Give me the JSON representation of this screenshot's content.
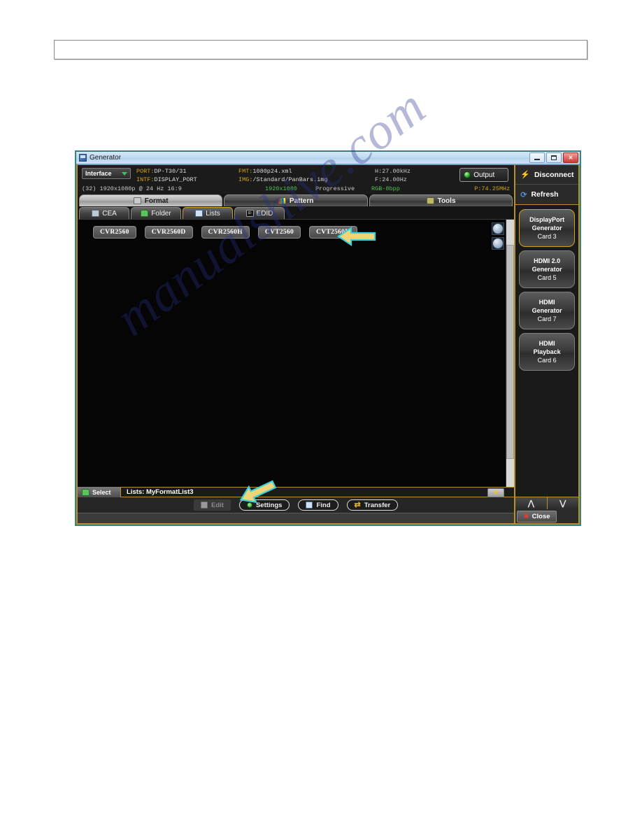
{
  "window": {
    "title": "Generator",
    "controls": {
      "minimize": "–",
      "maximize": "□",
      "close": "✕"
    }
  },
  "info": {
    "interface_label": "Interface",
    "port_key": "PORT:",
    "port_value": "DP-T30/31",
    "intf_key": "INTF:",
    "intf_value": "DISPLAY_PORT",
    "fmt_key": "FMT:",
    "fmt_value": "1080p24.xml",
    "img_key": "IMG:",
    "img_value": "/Standard/PanBars.img",
    "h_freq": "H:27.00kHz",
    "f_freq": "F:24.00Hz",
    "output_label": "Output",
    "format_desc": "(32) 1920x1080p @ 24 Hz 16:9",
    "resolution": "1920x1080",
    "scan": "Progressive",
    "color_depth": "RGB-8bpp",
    "pixel_clock": "P:74.25MHz"
  },
  "tabs_main": [
    {
      "label": "Format",
      "icon": "monitor-icon",
      "active": true
    },
    {
      "label": "Pattern",
      "icon": "pattern-icon",
      "active": false
    },
    {
      "label": "Tools",
      "icon": "tools-icon",
      "active": false
    }
  ],
  "tabs_sub": [
    {
      "label": "CEA",
      "icon": "cea-icon",
      "active": false
    },
    {
      "label": "Folder",
      "icon": "folder-icon",
      "active": false
    },
    {
      "label": "Lists",
      "icon": "lists-icon",
      "active": true
    },
    {
      "label": "EDID",
      "icon": "edid-icon",
      "active": false
    }
  ],
  "format_chips": [
    {
      "label": "CVR2560"
    },
    {
      "label": "CVR2560D"
    },
    {
      "label": "CVR2560H"
    },
    {
      "label": "CVT2560"
    },
    {
      "label": "CVT2560H"
    }
  ],
  "list_bar": {
    "select_label": "Select",
    "list_text": "Lists: MyFormatList3",
    "star_glyph": "★"
  },
  "actions": [
    {
      "label": "Edit",
      "icon": "edit-icon",
      "disabled": true
    },
    {
      "label": "Settings",
      "icon": "settings-icon",
      "disabled": false
    },
    {
      "label": "Find",
      "icon": "find-icon",
      "disabled": false
    },
    {
      "label": "Transfer",
      "icon": "transfer-icon",
      "disabled": false
    }
  ],
  "sidebar": {
    "disconnect_label": "Disconnect",
    "refresh_label": "Refresh",
    "cards": [
      {
        "line1": "DisplayPort",
        "line2": "Generator",
        "line3": "Card 3",
        "active": true
      },
      {
        "line1": "HDMI 2.0",
        "line2": "Generator",
        "line3": "Card 5",
        "active": false
      },
      {
        "line1": "HDMI",
        "line2": "Generator",
        "line3": "Card 7",
        "active": false
      },
      {
        "line1": "HDMI",
        "line2": "Playback",
        "line3": "Card 6",
        "active": false
      }
    ],
    "nav_up": "⋀",
    "nav_down": "⋁",
    "close_label": "Close"
  },
  "watermark": {
    "text": "manualshive.com"
  },
  "colors": {
    "accent_gold": "#b8912e",
    "frame_teal": "#2f7a78",
    "arrow_fill": "#f0d477",
    "arrow_stroke": "#3fd0d8",
    "led_green": "#27a12a"
  }
}
